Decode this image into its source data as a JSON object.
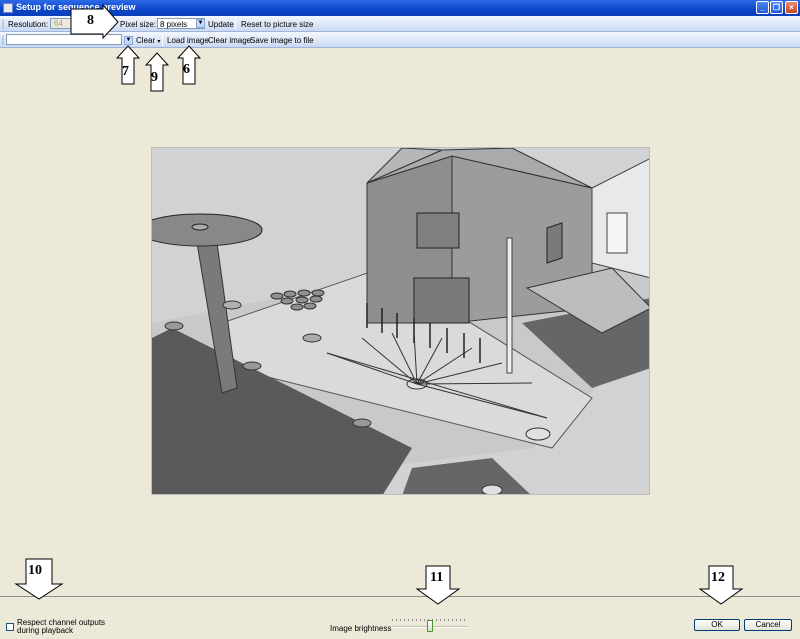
{
  "window": {
    "title": "Setup for sequence preview"
  },
  "toolbar1": {
    "resolution_label": "Resolution:",
    "resolution_value": "64",
    "pixel_size_label": "Pixel size:",
    "pixel_size_value": "8 pixels",
    "update_label": "Update",
    "reset_label": "Reset to picture size"
  },
  "toolbar2": {
    "clear_label": "Clear",
    "load_image_label": "Load image",
    "clear_image_label": "Clear image",
    "save_image_label": "Save image to file"
  },
  "bottom": {
    "respect_label": "Respect channel outputs during playback",
    "brightness_label": "Image brightness",
    "brightness_value": 0.5,
    "ok_label": "OK",
    "cancel_label": "Cancel"
  },
  "callouts": {
    "c6": "6",
    "c7": "7",
    "c8": "8",
    "c9": "9",
    "c10": "10",
    "c11": "11",
    "c12": "12"
  },
  "colors": {
    "titlebar": "#0a45c7",
    "toolbar": "#c9d9f3",
    "background": "#ece9d8"
  }
}
